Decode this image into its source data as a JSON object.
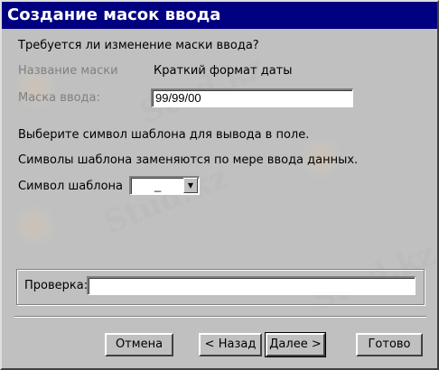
{
  "window": {
    "title": "Создание масок ввода"
  },
  "question": "Требуется ли изменение маски ввода?",
  "mask_name": {
    "label": "Название маски",
    "value": "Краткий формат даты"
  },
  "input_mask": {
    "label": "Маска ввода:",
    "value": "99/99/00"
  },
  "hint_line1": "Выберите символ шаблона для вывода в поле.",
  "hint_line2": "Символы шаблона заменяются по мере ввода данных.",
  "placeholder_char": {
    "label": "Символ шаблона",
    "value": "_"
  },
  "test": {
    "label": "Проверка:",
    "value": ""
  },
  "buttons": {
    "cancel": "Отмена",
    "back": "< Назад",
    "next": "Далее >",
    "finish": "Готово"
  },
  "watermark": "Stud.kz"
}
